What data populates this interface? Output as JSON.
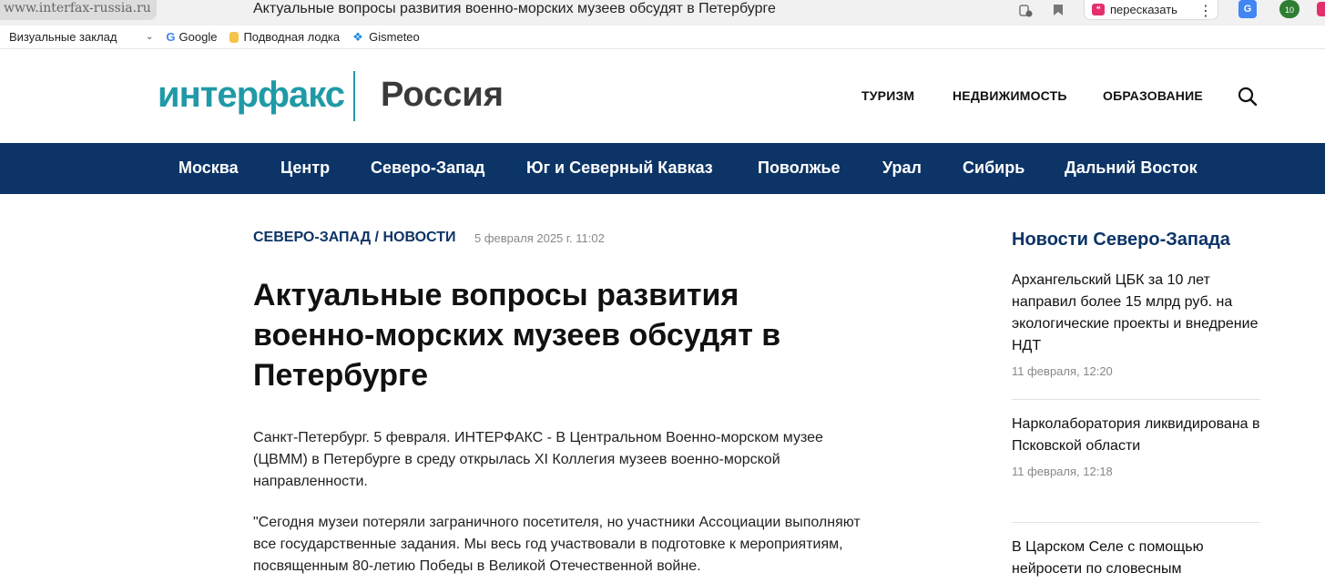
{
  "browser": {
    "url": "www.interfax-russia.ru",
    "tab_title": "Актуальные вопросы развития военно-морских музеев обсудят в Петербурге",
    "retell_label": "пересказать",
    "ext_translate_label": "G",
    "ext_badge_count": "10"
  },
  "bookmarks": [
    {
      "label": "Визуальные заклад",
      "icon": "folder-icon"
    },
    {
      "label": "Google",
      "icon": "google-icon"
    },
    {
      "label": "Подводная лодка",
      "icon": "submarine-icon"
    },
    {
      "label": "Gismeteo",
      "icon": "gismeteo-icon"
    }
  ],
  "header": {
    "logo": "интерфакс",
    "region": "Россия",
    "links": [
      "ТУРИЗМ",
      "НЕДВИЖИМОСТЬ",
      "ОБРАЗОВАНИЕ"
    ]
  },
  "nav": {
    "items": [
      "Москва",
      "Центр",
      "Северо-Запад",
      "Юг и Северный Кавказ",
      "Поволжье",
      "Урал",
      "Сибирь",
      "Дальний Восток"
    ]
  },
  "article": {
    "breadcrumb": "СЕВЕРО-ЗАПАД / НОВОСТИ",
    "date": "5 февраля 2025 г. 11:02",
    "headline": "Актуальные вопросы развития военно-морских музеев обсудят в Петербурге",
    "paragraphs": [
      "Санкт-Петербург. 5 февраля. ИНТЕРФАКС - В Центральном Военно-морском музее (ЦВММ) в Петербурге в среду открылась XI Коллегия музеев военно-морской направленности.",
      "\"Сегодня музеи потеряли заграничного посетителя, но участники Ассоциации выполняют все государственные задания. Мы весь год участвовали в подготовке к мероприятиям, посвященным 80-летию Победы в Великой Отечественной войне."
    ]
  },
  "sidebar": {
    "title": "Новости Северо-Запада",
    "items": [
      {
        "text": "Архангельский ЦБК за 10 лет направил более 15 млрд руб. на экологические проекты и внедрение НДТ",
        "date": "11 февраля, 12:20"
      },
      {
        "text": "Наркolaборатория ликвидирована в Псковской области",
        "date": "11 февраля, 12:18"
      },
      {
        "text": "В Царском Селе с помощью нейросети по словесным",
        "date": ""
      }
    ]
  },
  "colors": {
    "brand_teal": "#1f9aa6",
    "nav_blue": "#0c3466"
  }
}
